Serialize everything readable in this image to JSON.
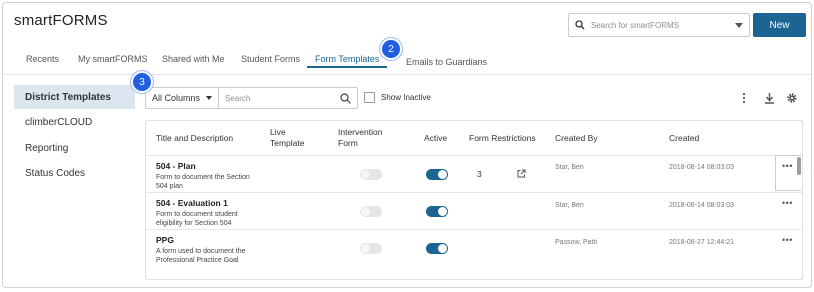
{
  "app": {
    "title": "smartFORMS"
  },
  "header": {
    "search_placeholder": "Search for smartFORMS",
    "new_label": "New"
  },
  "tabs": [
    {
      "label": "Recents",
      "active": false
    },
    {
      "label": "My smartFORMS",
      "active": false
    },
    {
      "label": "Shared with Me",
      "active": false
    },
    {
      "label": "Student Forms",
      "active": false
    },
    {
      "label": "Form Templates",
      "active": true
    },
    {
      "label": "Emails to Guardians",
      "active": false
    }
  ],
  "callouts": {
    "tabs_badge": "2",
    "filter_badge": "3"
  },
  "sidebar": {
    "items": [
      {
        "label": "District Templates",
        "active": true
      },
      {
        "label": "climberCLOUD",
        "active": false
      },
      {
        "label": "Reporting",
        "active": false
      },
      {
        "label": "Status Codes",
        "active": false
      }
    ]
  },
  "filters": {
    "column_select": "All Columns",
    "search_placeholder": "Search",
    "show_inactive_label": "Show Inactive"
  },
  "table": {
    "headers": {
      "title": "Title and Description",
      "live_line1": "Live",
      "live_line2": "Template",
      "intervention_line1": "Intervention",
      "intervention_line2": "Form",
      "active": "Active",
      "restrictions": "Form Restrictions",
      "created_by": "Created By",
      "created": "Created"
    },
    "rows": [
      {
        "title": "504 - Plan",
        "desc_line1": "Form to document the Section",
        "desc_line2": "504 plan",
        "intervention_on": false,
        "active_on": true,
        "restrictions": "3",
        "created_by": "Star, Ben",
        "created": "2018-08-14 08:03:03"
      },
      {
        "title": "504 - Evaluation 1",
        "desc_line1": "Form to document student",
        "desc_line2": "eligibility for Section 504",
        "intervention_on": false,
        "active_on": true,
        "restrictions": "",
        "created_by": "Star, Ben",
        "created": "2018-08-14 08:03:03"
      },
      {
        "title": "PPG",
        "desc_line1": "A form used to document the",
        "desc_line2": "Professional Practice Goal",
        "intervention_on": false,
        "active_on": true,
        "restrictions": "",
        "created_by": "Passow, Patti",
        "created": "2018-08-27 12:44:21"
      }
    ],
    "row_menu_label": "•••"
  },
  "colors": {
    "accent": "#1a6591",
    "callout": "#1f5fe0",
    "sidebar_active_bg": "#dbe6f1"
  }
}
